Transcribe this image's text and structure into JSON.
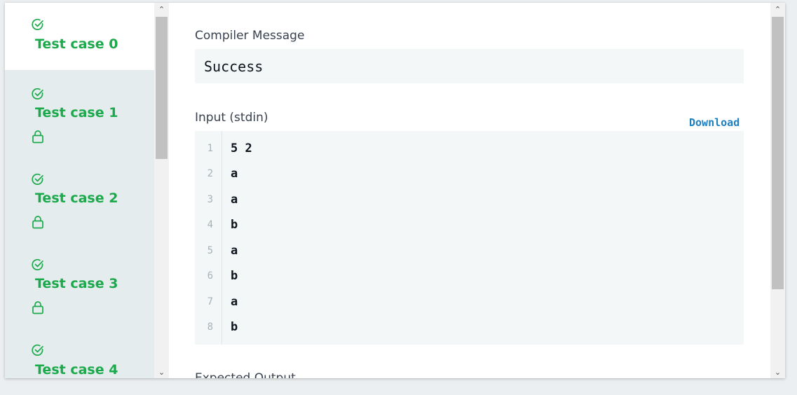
{
  "sidebar": {
    "test_cases": [
      {
        "label": "Test case 0",
        "locked": false,
        "active": true
      },
      {
        "label": "Test case 1",
        "locked": true,
        "active": false
      },
      {
        "label": "Test case 2",
        "locked": true,
        "active": false
      },
      {
        "label": "Test case 3",
        "locked": true,
        "active": false
      },
      {
        "label": "Test case 4",
        "locked": true,
        "active": false
      }
    ]
  },
  "main": {
    "compiler_message_title": "Compiler Message",
    "compiler_message": "Success",
    "input_title": "Input (stdin)",
    "download_label": "Download",
    "input_lines": [
      {
        "num": "1",
        "text": "5 2"
      },
      {
        "num": "2",
        "text": "a"
      },
      {
        "num": "3",
        "text": "a"
      },
      {
        "num": "4",
        "text": "b"
      },
      {
        "num": "5",
        "text": "a"
      },
      {
        "num": "6",
        "text": "b"
      },
      {
        "num": "7",
        "text": "a"
      },
      {
        "num": "8",
        "text": "b"
      }
    ],
    "expected_output_title": "Expected Output"
  },
  "colors": {
    "success": "#1ba94c",
    "link": "#1f7fbf",
    "code_bg": "#f3f7f7",
    "sidebar_bg": "#e5eced"
  }
}
